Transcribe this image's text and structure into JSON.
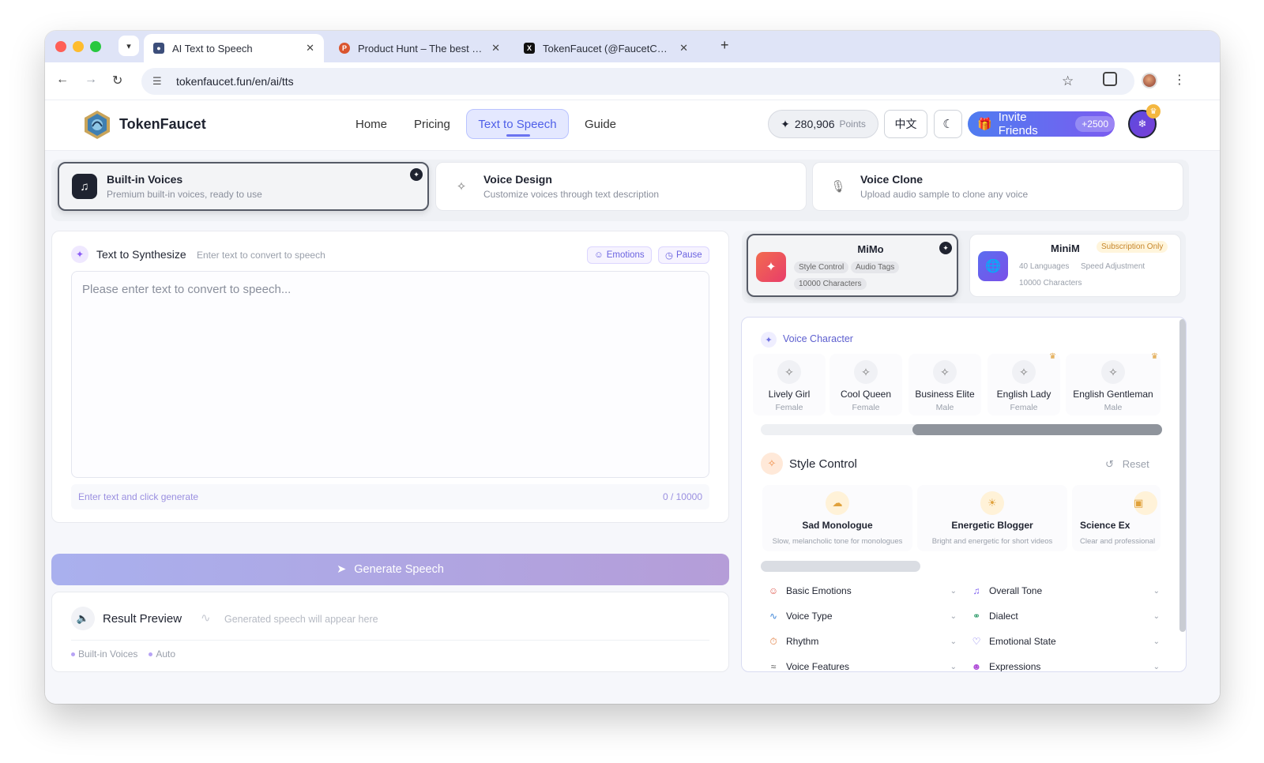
{
  "browser": {
    "tabs": [
      {
        "title": "AI Text to Speech",
        "active": true
      },
      {
        "title": "Product Hunt – The best new",
        "active": false
      },
      {
        "title": "TokenFaucet (@FaucetCgei) /",
        "active": false
      }
    ],
    "url": "tokenfaucet.fun/en/ai/tts"
  },
  "header": {
    "brand": "TokenFaucet",
    "nav": [
      "Home",
      "Pricing",
      "Text to Speech",
      "Guide"
    ],
    "active_nav": "Text to Speech",
    "points_value": "280,906",
    "points_unit": "Points",
    "lang_button": "中文",
    "invite_label": "Invite Friends",
    "invite_bonus": "+2500"
  },
  "modes": [
    {
      "title": "Built-in Voices",
      "subtitle": "Premium built-in voices, ready to use",
      "icon": "music-note-icon",
      "active": true
    },
    {
      "title": "Voice Design",
      "subtitle": "Customize voices through text description",
      "icon": "magic-wand-icon",
      "active": false
    },
    {
      "title": "Voice Clone",
      "subtitle": "Upload audio sample to clone any voice",
      "icon": "microphone-icon",
      "active": false
    }
  ],
  "synthesize": {
    "title": "Text to Synthesize",
    "hint": "Enter text to convert to speech",
    "emotions_chip": "Emotions",
    "pause_chip": "Pause",
    "placeholder": "Please enter text to convert to speech...",
    "footer_hint": "Enter text and click generate",
    "char_count": "0 / 10000"
  },
  "generate_button": "Generate Speech",
  "result": {
    "title": "Result Preview",
    "hint": "Generated speech will appear here",
    "tags": [
      "Built-in Voices",
      "Auto"
    ]
  },
  "models": [
    {
      "name": "MiMo",
      "tags": [
        "Style Control",
        "Audio Tags"
      ],
      "limit": "10000 Characters",
      "active": true
    },
    {
      "name": "MiniM",
      "tags": [
        "40 Languages",
        "Speed Adjustment"
      ],
      "limit": "10000 Characters",
      "badge": "Subscription Only",
      "active": false
    }
  ],
  "voice_character": {
    "title": "Voice Character",
    "voices": [
      {
        "name": "Lively Girl",
        "gender": "Female",
        "premium": false
      },
      {
        "name": "Cool Queen",
        "gender": "Female",
        "premium": false
      },
      {
        "name": "Business Elite",
        "gender": "Male",
        "premium": false
      },
      {
        "name": "English Lady",
        "gender": "Female",
        "premium": true
      },
      {
        "name": "English Gentleman",
        "gender": "Male",
        "premium": true
      }
    ]
  },
  "style_control": {
    "title": "Style Control",
    "reset": "Reset",
    "presets": [
      {
        "name": "Sad Monologue",
        "desc": "Slow, melancholic tone for monologues"
      },
      {
        "name": "Energetic Blogger",
        "desc": "Bright and energetic for short videos"
      },
      {
        "name": "Science Ex",
        "desc": "Clear and professional"
      }
    ],
    "options": [
      {
        "label": "Basic Emotions",
        "icon": "smile-icon"
      },
      {
        "label": "Overall Tone",
        "icon": "music-note-icon"
      },
      {
        "label": "Voice Type",
        "icon": "waveform-icon"
      },
      {
        "label": "Dialect",
        "icon": "globe-icon"
      },
      {
        "label": "Rhythm",
        "icon": "timer-icon"
      },
      {
        "label": "Emotional State",
        "icon": "heart-icon"
      },
      {
        "label": "Voice Features",
        "icon": "waves-icon"
      },
      {
        "label": "Expressions",
        "icon": "mask-icon"
      }
    ]
  },
  "colors": {
    "accent": "#4f5fe8",
    "invite_start": "#4f7cf0",
    "invite_end": "#7b5cf0",
    "generate": "#a9b0ee"
  }
}
